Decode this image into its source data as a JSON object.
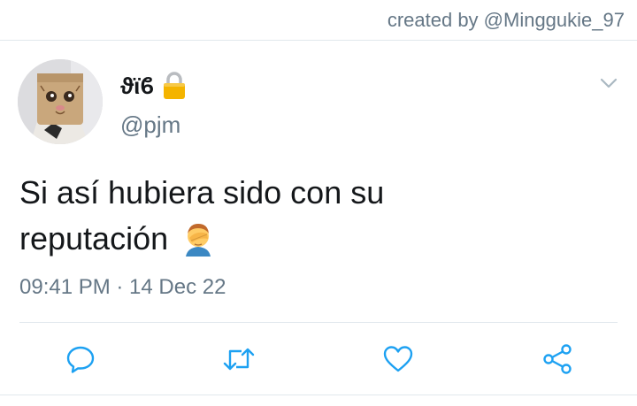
{
  "header": {
    "credit": "created by @Minggukie_97"
  },
  "tweet": {
    "display_name": "ϑϊϐ",
    "handle": "@pjm",
    "text_line_1": "Si así hubiera sido con su",
    "text_line_2": "reputación",
    "emoji": "facepalm-icon",
    "timestamp": "09:41 PM · 14 Dec 22",
    "locked_icon": "lock-icon"
  },
  "actions": {
    "reply_icon": "reply-icon",
    "retweet_icon": "retweet-icon",
    "like_icon": "heart-icon",
    "share_icon": "share-icon"
  },
  "colors": {
    "primary_text": "#14171a",
    "secondary_text": "#657786",
    "divider": "#e1e8ed",
    "icon": "#1da1f2"
  }
}
